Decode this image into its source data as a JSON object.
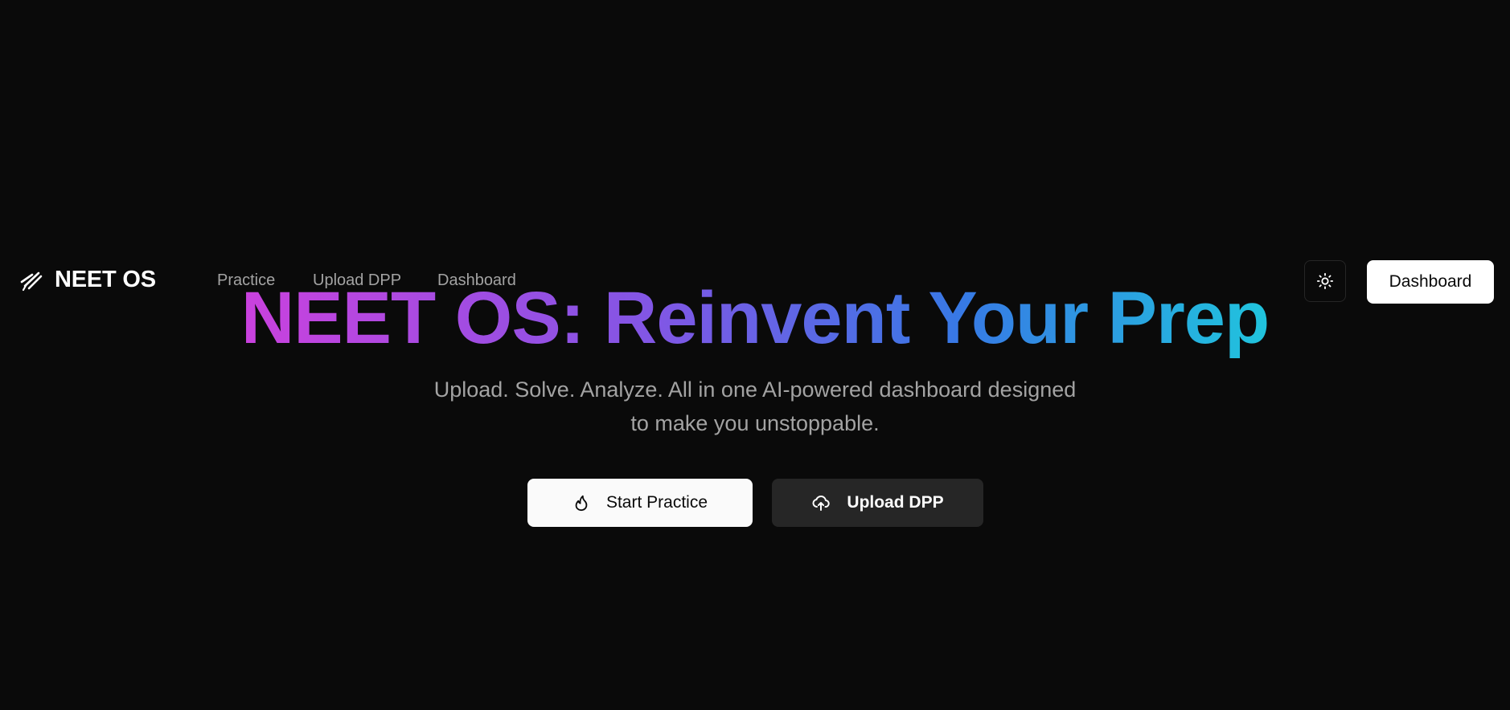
{
  "header": {
    "brand": "NEET OS",
    "brand_icon": "feather-logo-icon",
    "nav": [
      {
        "label": "Practice"
      },
      {
        "label": "Upload DPP"
      },
      {
        "label": "Dashboard"
      }
    ],
    "theme_toggle_icon": "sun-icon",
    "dashboard_button": "Dashboard"
  },
  "hero": {
    "title": "NEET OS: Reinvent Your Prep",
    "subtitle_line1": "Upload. Solve. Analyze. All in one AI-powered dashboard designed",
    "subtitle_line2": "to make you unstoppable.",
    "primary_cta": {
      "label": "Start Practice",
      "icon": "flame-icon"
    },
    "secondary_cta": {
      "label": "Upload DPP",
      "icon": "cloud-upload-icon"
    }
  },
  "colors": {
    "background": "#0a0a0a",
    "gradient_start": "#d946ef",
    "gradient_mid": "#8b5cf6",
    "gradient_blue": "#3b82f6",
    "gradient_end": "#22d3ee",
    "muted_text": "#a3a3a3"
  }
}
